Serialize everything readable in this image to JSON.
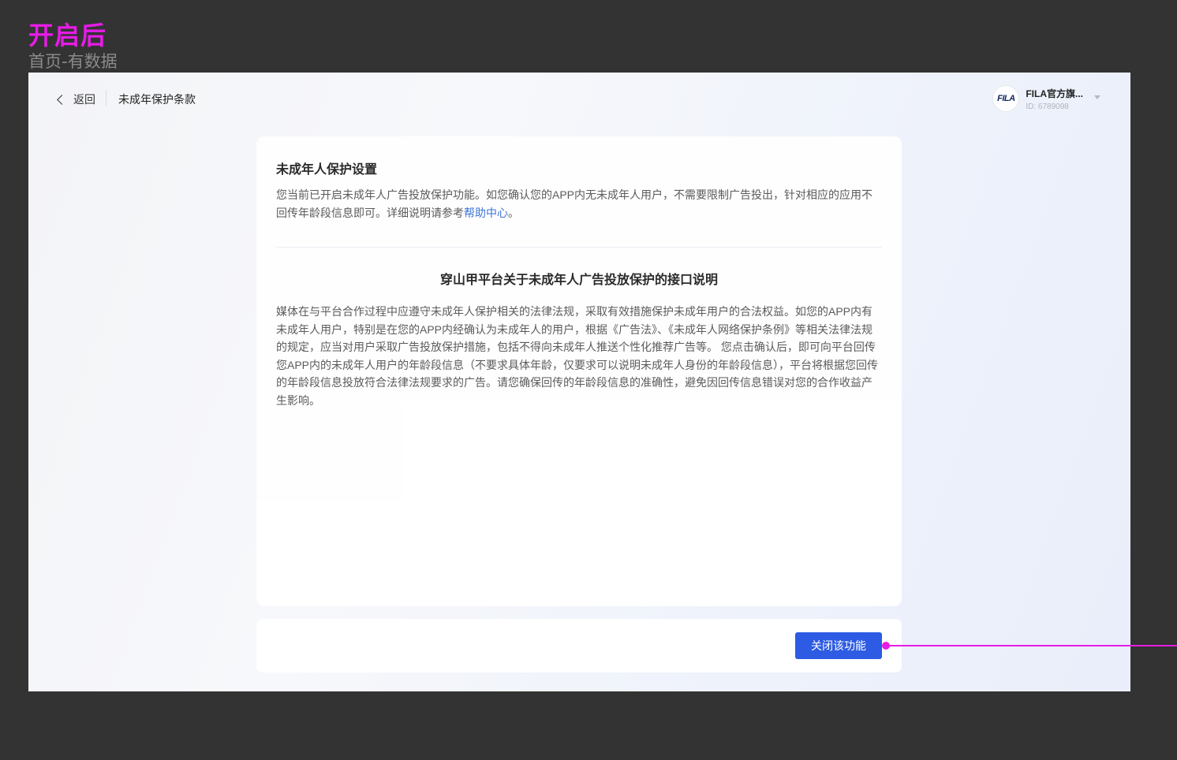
{
  "annotation": {
    "title": "开启后",
    "subtitle": "首页-有数据"
  },
  "header": {
    "back_label": "返回",
    "page_title": "未成年保护条款",
    "account": {
      "logo_text": "FILA",
      "name": "FILA官方旗...",
      "id": "ID: 6789098"
    }
  },
  "settings": {
    "title": "未成年人保护设置",
    "description": "您当前已开启未成年人广告投放保护功能。如您确认您的APP内无未成年人用户，不需要限制广告投出，针对相应的应用不回传年龄段信息即可。详细说明请参考",
    "help_link": "帮助中心",
    "description_end": "。"
  },
  "document": {
    "title": "穿山甲平台关于未成年人广告投放保护的接口说明",
    "body": "媒体在与平台合作过程中应遵守未成年人保护相关的法律法规，采取有效措施保护未成年用户的合法权益。如您的APP内有未成年人用户，特别是在您的APP内经确认为未成年人的用户，根据《广告法》、《未成年人网络保护条例》等相关法律法规的规定，应当对用户采取广告投放保护措施，包括不得向未成年人推送个性化推荐广告等。 您点击确认后，即可向平台回传您APP内的未成年人用户的年龄段信息（不要求具体年龄，仅要求可以说明未成年人身份的年龄段信息），平台将根据您回传的年龄段信息投放符合法律法规要求的广告。请您确保回传的年龄段信息的准确性，避免因回传信息错误对您的合作收益产生影响。"
  },
  "footer": {
    "close_button": "关闭该功能"
  },
  "colors": {
    "annotation": "#e61ce6",
    "primary": "#2d5be3",
    "link": "#3670d6"
  }
}
